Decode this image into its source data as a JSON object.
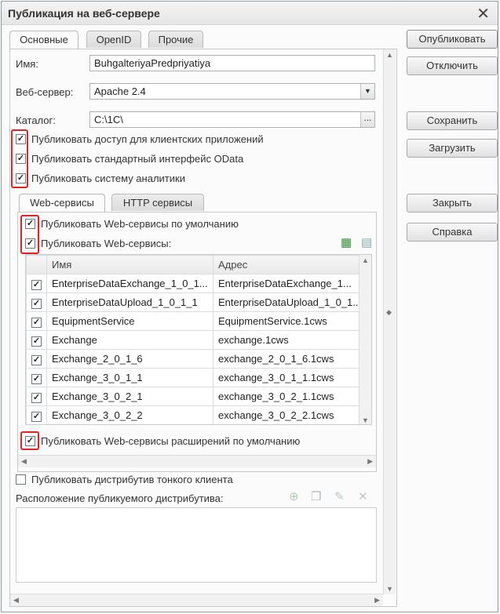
{
  "window": {
    "title": "Публикация на веб-сервере",
    "close_glyph": "✕"
  },
  "tabs": [
    {
      "label": "Основные",
      "active": true
    },
    {
      "label": "OpenID",
      "active": false
    },
    {
      "label": "Прочие",
      "active": false
    }
  ],
  "form": {
    "name_label": "Имя:",
    "name_value": "BuhgalteriyaPredpriyatiya",
    "webserver_label": "Веб-сервер:",
    "webserver_value": "Apache 2.4",
    "catalog_label": "Каталог:",
    "catalog_value": "C:\\1C\\",
    "catalog_button": "..."
  },
  "publish_options": [
    {
      "label": "Публиковать доступ для клиентских приложений",
      "checked": true
    },
    {
      "label": "Публиковать стандартный интерфейс OData",
      "checked": true
    },
    {
      "label": "Публиковать систему аналитики",
      "checked": true
    }
  ],
  "inner_tabs": [
    {
      "label": "Web-сервисы",
      "active": true
    },
    {
      "label": "HTTP сервисы",
      "active": false
    }
  ],
  "ws": {
    "default_label": "Публиковать Web-сервисы по умолчанию",
    "publish_label": "Публиковать Web-сервисы:",
    "ext_default_label": "Публиковать Web-сервисы расширений по умолчанию",
    "columns": {
      "name": "Имя",
      "address": "Адрес"
    },
    "rows": [
      {
        "name": "EnterpriseDataExchange_1_0_1...",
        "address": "EnterpriseDataExchange_1...",
        "checked": true
      },
      {
        "name": "EnterpriseDataUpload_1_0_1_1",
        "address": "EnterpriseDataUpload_1_0_1...",
        "checked": true
      },
      {
        "name": "EquipmentService",
        "address": "EquipmentService.1cws",
        "checked": true
      },
      {
        "name": "Exchange",
        "address": "exchange.1cws",
        "checked": true
      },
      {
        "name": "Exchange_2_0_1_6",
        "address": "exchange_2_0_1_6.1cws",
        "checked": true
      },
      {
        "name": "Exchange_3_0_1_1",
        "address": "exchange_3_0_1_1.1cws",
        "checked": true
      },
      {
        "name": "Exchange_3_0_2_1",
        "address": "exchange_3_0_2_1.1cws",
        "checked": true
      },
      {
        "name": "Exchange_3_0_2_2",
        "address": "exchange_3_0_2_2.1cws",
        "checked": true
      }
    ]
  },
  "distrib": {
    "publish_label": "Публиковать дистрибутив тонкого клиента",
    "publish_checked": false,
    "location_label": "Расположение публикуемого дистрибутива:"
  },
  "side_buttons": {
    "publish": "Опубликовать",
    "disable": "Отключить",
    "save": "Сохранить",
    "load": "Загрузить",
    "close": "Закрыть",
    "help": "Справка"
  },
  "colors": {
    "highlight": "#e02424",
    "accent_green": "#4caf50"
  }
}
